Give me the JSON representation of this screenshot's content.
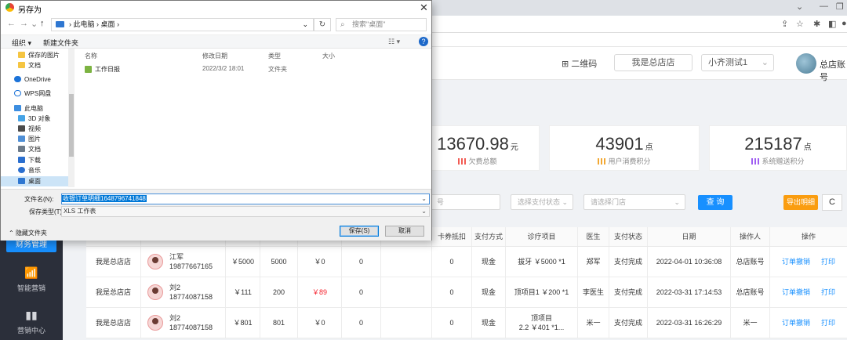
{
  "dialog": {
    "title": "另存为",
    "path": [
      "此电脑",
      "桌面"
    ],
    "search_placeholder": "搜索\"桌面\"",
    "toolbar": {
      "organize": "组织 ▾",
      "new_folder": "新建文件夹"
    },
    "tree": [
      {
        "label": "保存的图片",
        "color": "#f5c542"
      },
      {
        "label": "文档",
        "color": "#f5c542"
      },
      {
        "label": "OneDrive",
        "color": "#1c73d8"
      },
      {
        "label": "WPS网盘",
        "color": "#1c73d8"
      },
      {
        "label": "此电脑",
        "color": "#3d8ee0"
      },
      {
        "label": "3D 对象",
        "color": "#45a3e6"
      },
      {
        "label": "视频",
        "color": "#4b4b4b"
      },
      {
        "label": "图片",
        "color": "#4f8fd6"
      },
      {
        "label": "文档",
        "color": "#6c7a89"
      },
      {
        "label": "下载",
        "color": "#2b6fcf"
      },
      {
        "label": "音乐",
        "color": "#2b6fcf"
      },
      {
        "label": "桌面",
        "color": "#2f77d1"
      }
    ],
    "columns": {
      "name": "名称",
      "modified": "修改日期",
      "type": "类型",
      "size": "大小"
    },
    "files": [
      {
        "name": "工作日报",
        "modified": "2022/3/2 18:01",
        "type": "文件夹"
      }
    ],
    "filename_label": "文件名(N):",
    "filename_value": "收银订单明细1648796741848",
    "filetype_label": "保存类型(T):",
    "filetype_value": "XLS 工作表",
    "hide_folders": "隐藏文件夹",
    "save_btn": "保存(S)",
    "cancel_btn": "取消"
  },
  "header": {
    "qrcode": "二维码",
    "store": "我是总店店",
    "branch": "小齐测试1",
    "account": "总店账号"
  },
  "stats": [
    {
      "value": "13670.98",
      "unit": "元",
      "label": "欠费总额",
      "color": "#f25c54"
    },
    {
      "value": "43901",
      "unit": "点",
      "label": "用户消费积分",
      "color": "#f2a833"
    },
    {
      "value": "215187",
      "unit": "点",
      "label": "系统赠送积分",
      "color": "#a05ef2"
    }
  ],
  "filters": {
    "order_placeholder": "号",
    "pay_status_placeholder": "选择支付状态",
    "store_placeholder": "请选择门店",
    "query": "查 询",
    "export": "导出明细",
    "refresh": "C"
  },
  "sidebar": {
    "active": "财务管理",
    "items": [
      {
        "label": "智能营销"
      },
      {
        "label": "营销中心"
      }
    ]
  },
  "table": {
    "headers": [
      "",
      "",
      "",
      "",
      "",
      "",
      "",
      "卡券抵扣",
      "支付方式",
      "诊疗项目",
      "医生",
      "支付状态",
      "日期",
      "操作人",
      "操作"
    ],
    "rows": [
      {
        "store": "我是总店店",
        "name": "江军",
        "phone": "19877667165",
        "amount": "￥5000",
        "points": "5000",
        "owed": "￥0",
        "c5": "0",
        "card": "0",
        "method": "现金",
        "item": "拔牙 ￥5000 *1",
        "doctor": "郑军",
        "status": "支付完成",
        "date": "2022-04-01 10:36:08",
        "operator": "总店账号",
        "op1": "订单撤销",
        "op2": "打印",
        "owed_red": false
      },
      {
        "store": "我是总店店",
        "name": "刘2",
        "phone": "18774087158",
        "amount": "￥111",
        "points": "200",
        "owed": "￥89",
        "c5": "0",
        "card": "0",
        "method": "现金",
        "item": "顶项目1 ￥200 *1",
        "doctor": "李医生",
        "status": "支付完成",
        "date": "2022-03-31 17:14:53",
        "operator": "总店账号",
        "op1": "订单撤销",
        "op2": "打印",
        "owed_red": true
      },
      {
        "store": "我是总店店",
        "name": "刘2",
        "phone": "18774087158",
        "amount": "￥801",
        "points": "801",
        "owed": "￥0",
        "c5": "0",
        "card": "0",
        "method": "现金",
        "item": "顶项目\n2.2 ￥401 *1...",
        "doctor": "米一",
        "status": "支付完成",
        "date": "2022-03-31 16:26:29",
        "operator": "米一",
        "op1": "订单撤销",
        "op2": "打印",
        "owed_red": false
      }
    ]
  }
}
